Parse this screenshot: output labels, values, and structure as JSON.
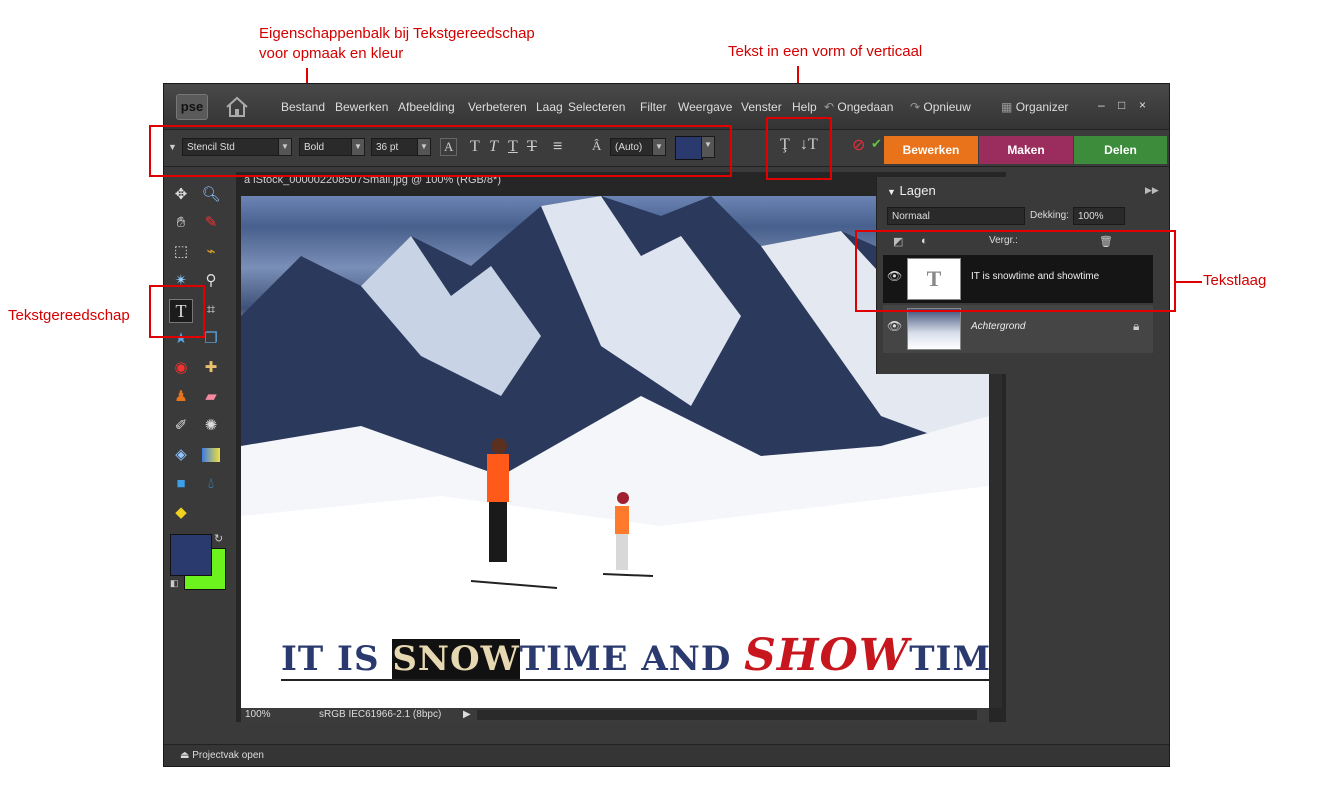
{
  "annotations": {
    "options_bar": "Eigenschappenbalk bij Tekstgereedschap",
    "options_bar_2": "voor opmaak en kleur",
    "text_shape": "Tekst in een vorm of verticaal",
    "text_tool": "Tekstgereedschap",
    "text_layer": "Tekstlaag"
  },
  "app": {
    "logo": "pse",
    "menu": [
      "Bestand",
      "Bewerken",
      "Afbeelding",
      "Verbeteren",
      "Laag",
      "Selecteren",
      "Filter",
      "Weergave",
      "Venster",
      "Help"
    ],
    "undo": "Ongedaan",
    "redo": "Opnieuw",
    "organizer": "Organizer",
    "win_minimize": "–",
    "win_maximize": "□",
    "win_close": "×"
  },
  "options": {
    "font": "Stencil Std",
    "style": "Bold",
    "size": "36 pt",
    "leading": "(Auto)",
    "color": "#2a3a6e",
    "aa": "A",
    "align": "≡"
  },
  "tabs": [
    {
      "label": "Bewerken",
      "color": "#e8731a"
    },
    {
      "label": "Maken",
      "color": "#9a2d5d"
    },
    {
      "label": "Delen",
      "color": "#3c8c3c"
    }
  ],
  "document": {
    "title": "a iStock_000002208507Small.jpg @ 100% (RGB/8*)",
    "zoom": "100%",
    "profile": "sRGB IEC61966-2.1 (8bpc)",
    "headline_part1": "IT IS ",
    "headline_sel": "SNOW",
    "headline_part2": "TIME AND ",
    "headline_show": "SHOW",
    "headline_part3": "TIME"
  },
  "layers": {
    "title": "Lagen",
    "blend_mode": "Normaal",
    "opacity_label": "Dekking:",
    "opacity": "100%",
    "lock_label": "Vergr.:",
    "items": [
      {
        "name": "IT is snowtime and showtime",
        "thumb": "T"
      },
      {
        "name": "Achtergrond",
        "thumb": ""
      }
    ]
  },
  "bottom": {
    "projectbin": "Projectvak open"
  },
  "colors": {
    "annotation": "#e00000",
    "foreground": "#2a3a6e",
    "background": "#6cf21c"
  }
}
